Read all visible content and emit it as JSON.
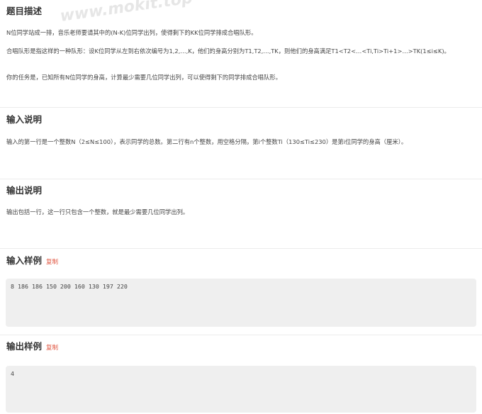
{
  "watermark": "www.mokit.top",
  "description": {
    "heading": "题目描述",
    "p1": "N位同学站成一排，音乐老师要请其中的(N-K)位同学出列，使得剩下的KK位同学排成合唱队形。",
    "p2": "合唱队形是指这样的一种队形：设K位同学从左到右依次编号为1,2,…,K，他们的身高分别为T1,T2,…,TK，则他们的身高满足T1<T2<…<Ti,Ti>Ti+1>…>TK(1≤i≤K)。",
    "p3": "你的任务是，已知所有N位同学的身高，计算最少需要几位同学出列，可以使得剩下的同学排成合唱队形。"
  },
  "input_desc": {
    "heading": "输入说明",
    "text": "输入的第一行是一个整数N（2≤N≤100），表示同学的总数。第二行有n个整数，用空格分隔，第i个整数Ti（130≤Ti≤230）是第i位同学的身高（厘米）。"
  },
  "output_desc": {
    "heading": "输出说明",
    "text": "输出包括一行，这一行只包含一个整数，就是最少需要几位同学出列。"
  },
  "sample_input": {
    "heading": "输入样例",
    "copy_label": "复制",
    "value": "8 186 186 150 200 160 130 197 220"
  },
  "sample_output": {
    "heading": "输出样例",
    "copy_label": "复制",
    "value": "4"
  },
  "colors": {
    "copy_link": "#e0543f",
    "sample_bg": "#efefef",
    "divider": "#ececec"
  }
}
